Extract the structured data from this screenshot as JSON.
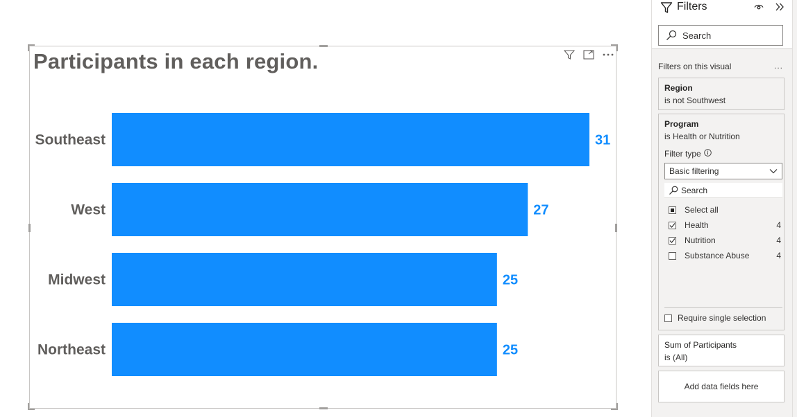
{
  "visual": {
    "header_icons": [
      "filter-icon",
      "focus-mode-icon",
      "more-options-icon"
    ]
  },
  "chart_data": {
    "type": "bar",
    "orientation": "horizontal",
    "title": "Participants in each region.",
    "categories": [
      "Southeast",
      "West",
      "Midwest",
      "Northeast"
    ],
    "values": [
      31,
      27,
      25,
      25
    ],
    "data_labels": [
      "31",
      "27",
      "25",
      "25"
    ],
    "bar_color": "#118dff",
    "label_color": "#118dff",
    "xlim": [
      0,
      31
    ],
    "grid": false,
    "x_axis_visible": false
  },
  "filters": {
    "title": "Filters",
    "search_placeholder": "Search",
    "section_label": "Filters on this visual",
    "section_more": "...",
    "region": {
      "title": "Region",
      "condition": "is not Southwest"
    },
    "program": {
      "title": "Program",
      "condition": "is Health or Nutrition",
      "filter_type_label": "Filter type",
      "filter_type_value": "Basic filtering",
      "search_placeholder": "Search",
      "select_all": "Select all",
      "options": [
        {
          "label": "Health",
          "count": "4",
          "checked": true
        },
        {
          "label": "Nutrition",
          "count": "4",
          "checked": true
        },
        {
          "label": "Substance Abuse",
          "count": "4",
          "checked": false
        }
      ],
      "require_single": "Require single selection"
    },
    "sum": {
      "title": "Sum of Participants",
      "condition": "is (All)"
    },
    "add_fields": "Add data fields here"
  }
}
